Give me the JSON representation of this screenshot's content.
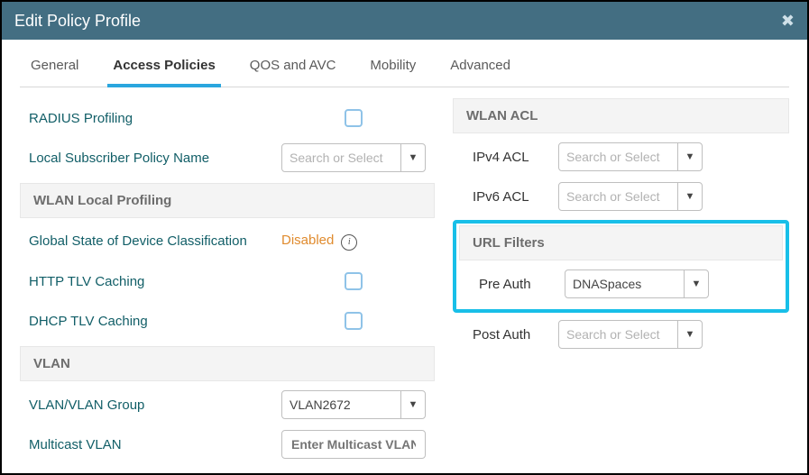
{
  "title": "Edit Policy Profile",
  "tabs": [
    "General",
    "Access Policies",
    "QOS and AVC",
    "Mobility",
    "Advanced"
  ],
  "active_tab_index": 1,
  "left": {
    "radius_profiling_label": "RADIUS Profiling",
    "local_sub_policy_label": "Local Subscriber Policy Name",
    "search_placeholder": "Search or Select",
    "wlan_local_profiling_header": "WLAN Local Profiling",
    "global_state_label": "Global State of Device Classification",
    "global_state_value": "Disabled",
    "http_tlv_label": "HTTP TLV Caching",
    "dhcp_tlv_label": "DHCP TLV Caching",
    "vlan_header": "VLAN",
    "vlan_group_label": "VLAN/VLAN Group",
    "vlan_group_value": "VLAN2672",
    "multicast_vlan_label": "Multicast VLAN",
    "multicast_vlan_placeholder": "Enter Multicast VLAN"
  },
  "right": {
    "wlan_acl_header": "WLAN ACL",
    "ipv4_label": "IPv4 ACL",
    "ipv6_label": "IPv6 ACL",
    "search_placeholder": "Search or Select",
    "url_filters_header": "URL Filters",
    "pre_auth_label": "Pre Auth",
    "pre_auth_value": "DNASpaces",
    "post_auth_label": "Post Auth"
  }
}
